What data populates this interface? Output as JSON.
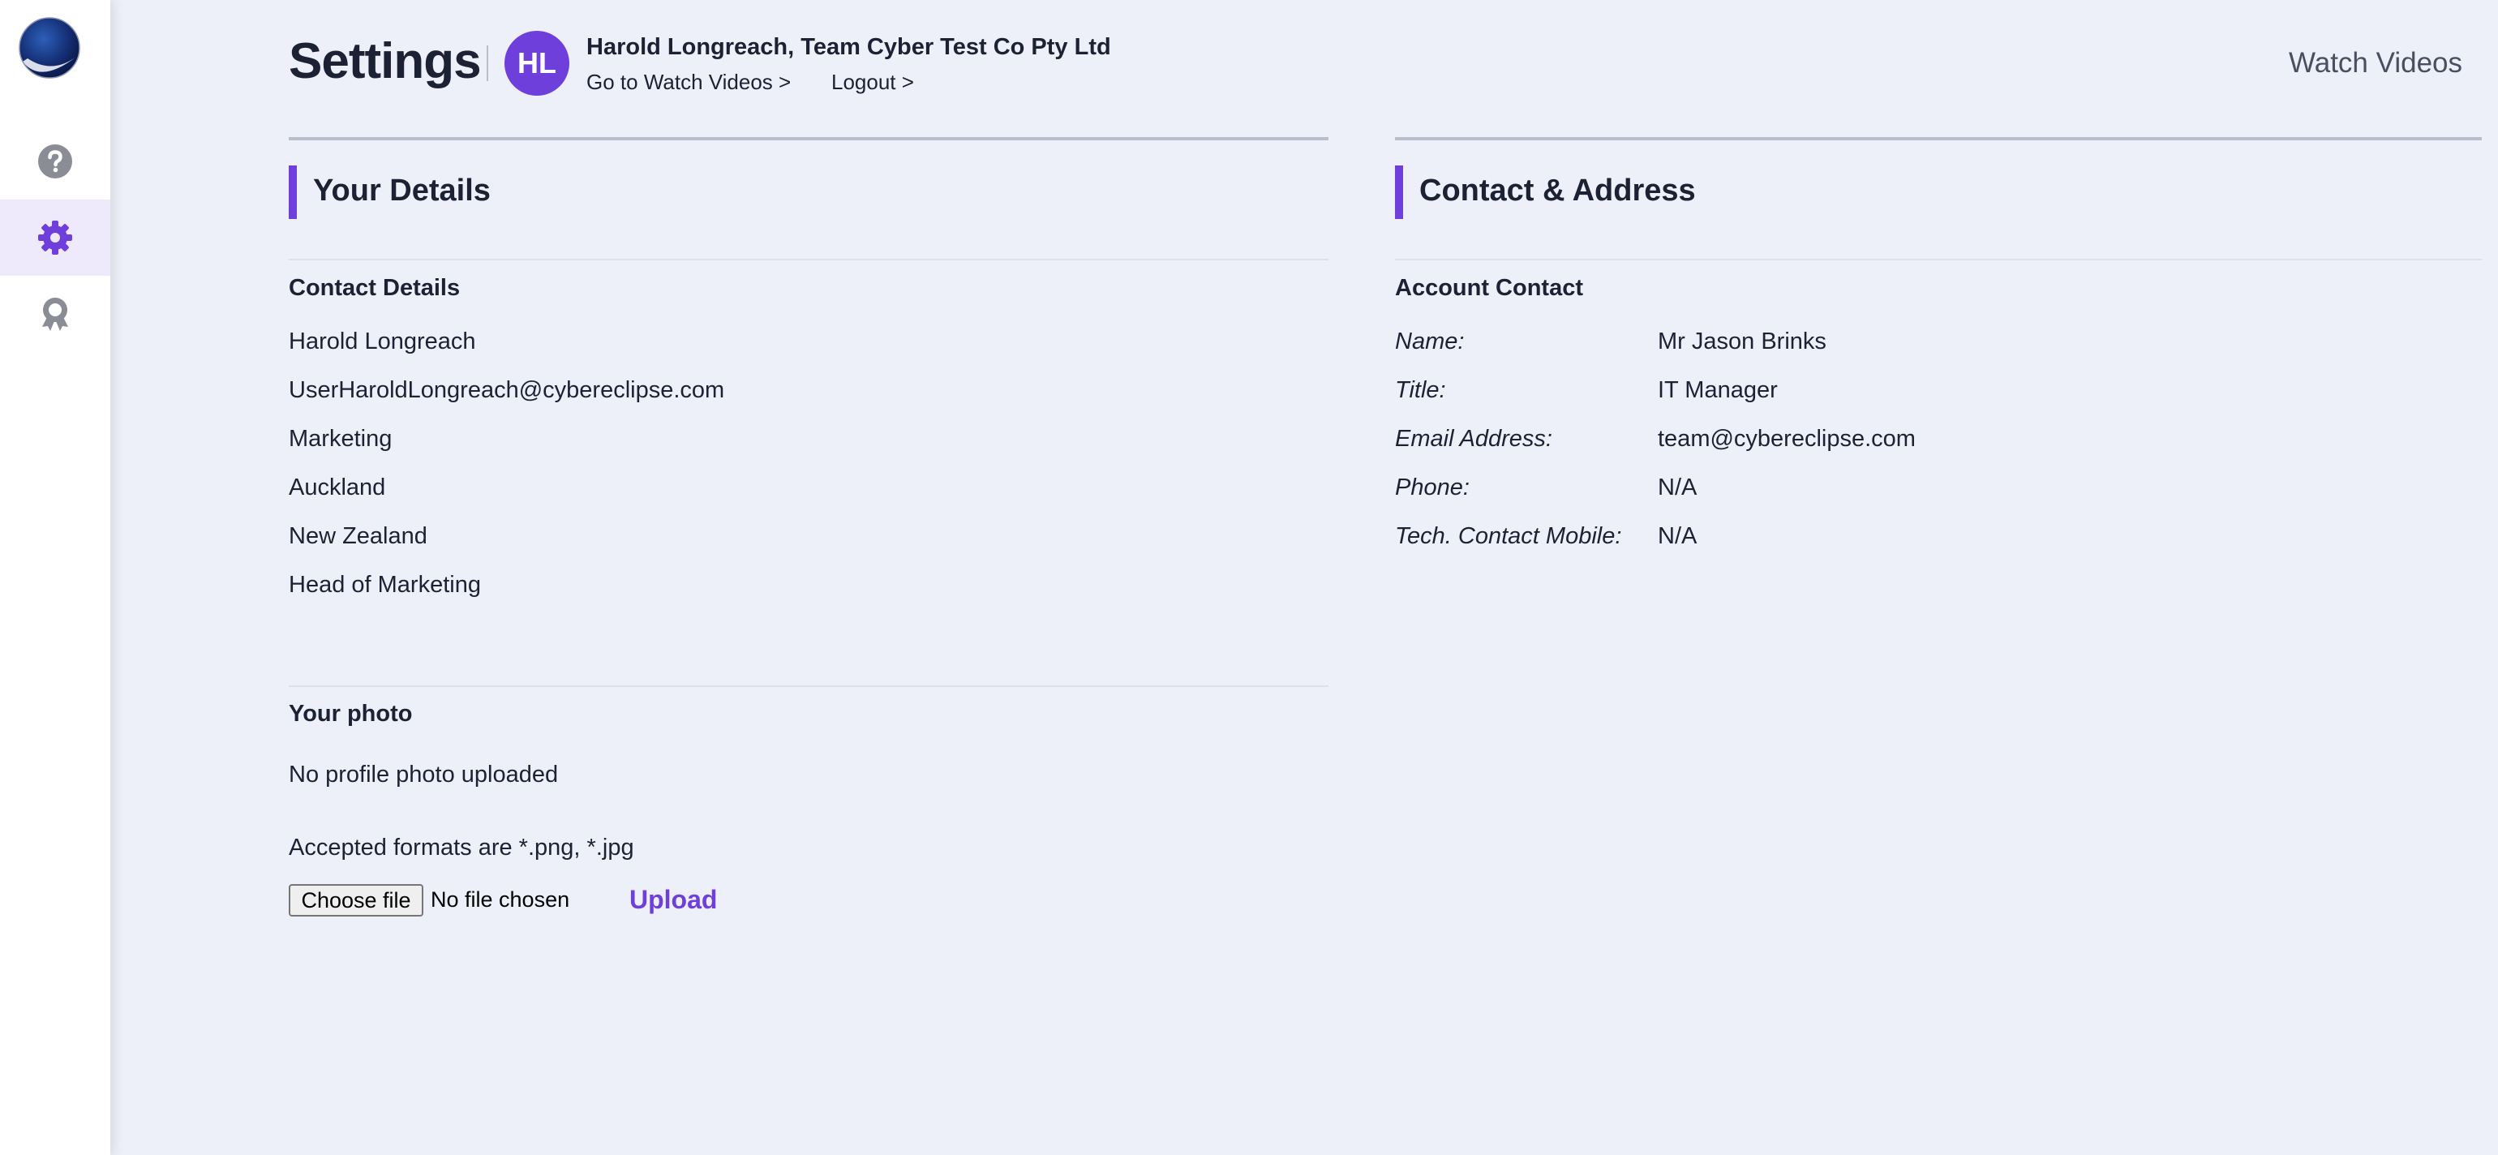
{
  "sidebar": {
    "logo": "globe-logo",
    "items": [
      {
        "icon": "help-icon",
        "active": false
      },
      {
        "icon": "gear-icon",
        "active": true
      },
      {
        "icon": "award-icon",
        "active": false
      }
    ]
  },
  "header": {
    "title": "Settings",
    "avatar_initials": "HL",
    "user_name": "Harold Longreach, Team Cyber Test Co Pty Ltd",
    "go_to_videos": "Go to Watch Videos >",
    "logout": "Logout >",
    "watch_videos": "Watch Videos"
  },
  "your_details": {
    "title": "Your Details",
    "contact_heading": "Contact Details",
    "lines": [
      "Harold Longreach",
      "UserHaroldLongreach@cybereclipse.com",
      "Marketing",
      "Auckland",
      "New Zealand",
      "Head of Marketing"
    ],
    "photo_heading": "Your photo",
    "no_photo": "No profile photo uploaded",
    "formats": "Accepted formats are *.png, *.jpg",
    "choose_file": "Choose file",
    "no_file": "No file chosen",
    "upload": "Upload"
  },
  "contact_address": {
    "title": "Contact & Address",
    "account_heading": "Account Contact",
    "rows": [
      {
        "label": "Name:",
        "value": "Mr Jason Brinks"
      },
      {
        "label": "Title:",
        "value": "IT Manager"
      },
      {
        "label": "Email Address:",
        "value": "team@cybereclipse.com"
      },
      {
        "label": "Phone:",
        "value": "N/A"
      },
      {
        "label": "Tech. Contact Mobile:",
        "value": "N/A"
      }
    ]
  },
  "colors": {
    "accent": "#6e3fdb",
    "background": "#eef0f9",
    "text": "#1c2133"
  }
}
